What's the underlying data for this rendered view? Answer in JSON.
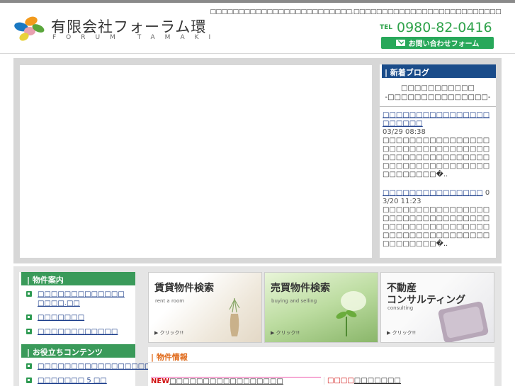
{
  "header": {
    "tagline": "□□□□□□□□□□□□□□□□□□□□□□□□□.□□□□□□□□□□□□□□□□□□□□□□□□□□",
    "company_name": "有限会社フォーラム環",
    "company_sub": "FORUM TAMAKI",
    "tel_label": "TEL",
    "tel_number": "0980-82-0416",
    "contact_label": "お問い合わせフォーム",
    "colors": {
      "brand_green": "#2ea24a",
      "nav_blue": "#1a4c8a"
    }
  },
  "blog": {
    "title": "新着ブログ",
    "caption_line1": "□□□□□□□□□□□",
    "caption_line2": "-□□□□□□□□□□□□□□□-",
    "entries": [
      {
        "link": "□□□□□□□□□□□□□□□□□□□□□□",
        "date": "03/29 08:38",
        "excerpt": "□□□□□□□□□□□□□□□□□□□□□□□□□□□□□□□□□□□□□□□□□□□□□□□□□□□□□□□□□□□□□□□□□□□□□□□□�.."
      },
      {
        "link": "□□□□□□□□□□□□□□□",
        "date": "03/20 11:23",
        "excerpt": "□□□□□□□□□□□□□□□□□□□□□□□□□□□□□□□□□□□□□□□□□□□□□□□□□□□□□□□□□□□□□□□□□□□□□□□□�.."
      }
    ]
  },
  "sidebar": {
    "section1_title": "物件案内",
    "section1_items": [
      "□□□□□□□□□□□□□ □□□□.□□",
      "□□□□□□□",
      "□□□□□□□□□□□□"
    ],
    "section2_title": "お役立ちコンテンツ",
    "section2_items": [
      "□□□□□□□□□□□□□□□□□",
      "□□□□□□□ 5 □□"
    ]
  },
  "cards": [
    {
      "title": "賃貸物件検索",
      "sub": "rent a room",
      "click": "▶ クリック!!"
    },
    {
      "title": "売買物件検索",
      "sub": "buying and selling",
      "click": "▶ クリック!!"
    },
    {
      "title_line1": "不動産",
      "title_line2": "コンサルティング",
      "sub": "consulting",
      "click": "▶ クリック!!"
    }
  ],
  "bukken": {
    "title": "物件情報",
    "left_new": "NEW",
    "left_text": "□□□□□□□□□□□□□□□□□",
    "right_red": "□□□□",
    "right_text": "□□□□□□□"
  }
}
